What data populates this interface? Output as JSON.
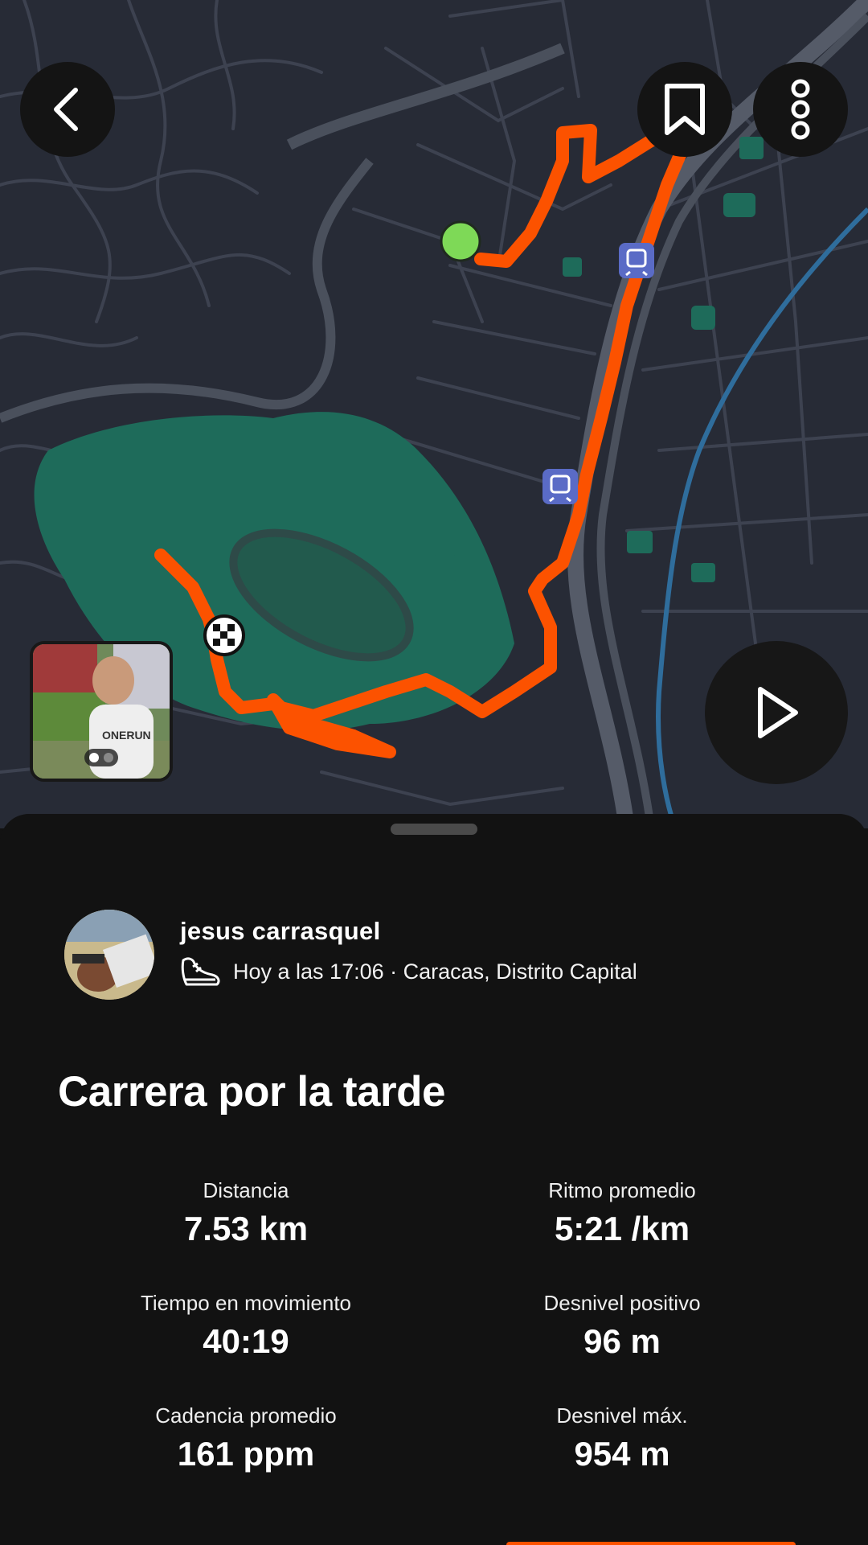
{
  "map": {
    "route_color": "#fc5200",
    "start_color": "#7ed957",
    "park_color": "#1e6b5a",
    "start_icon": "start-dot-icon",
    "finish_icon": "checkered-flag-icon",
    "transit_icon": "train-station-icon"
  },
  "toolbar": {
    "back_icon": "chevron-left-icon",
    "bookmark_icon": "bookmark-icon",
    "more_icon": "more-vertical-icon",
    "play_icon": "play-icon"
  },
  "athlete": {
    "name": "jesus carrasquel",
    "activity_icon": "running-shoe-icon",
    "meta": "Hoy a las 17:06 · Caracas, Distrito Capital"
  },
  "activity": {
    "title": "Carrera por la tarde"
  },
  "stats": [
    {
      "label": "Distancia",
      "value": "7.53 km"
    },
    {
      "label": "Ritmo promedio",
      "value": "5:21 /km"
    },
    {
      "label": "Tiempo en movimiento",
      "value": "40:19"
    },
    {
      "label": "Desnivel positivo",
      "value": "96 m"
    },
    {
      "label": "Cadencia promedio",
      "value": "161 ppm"
    },
    {
      "label": "Desnivel máx.",
      "value": "954 m"
    }
  ],
  "colors": {
    "accent": "#fc5200",
    "background": "#121212",
    "map_background": "#272b36"
  }
}
